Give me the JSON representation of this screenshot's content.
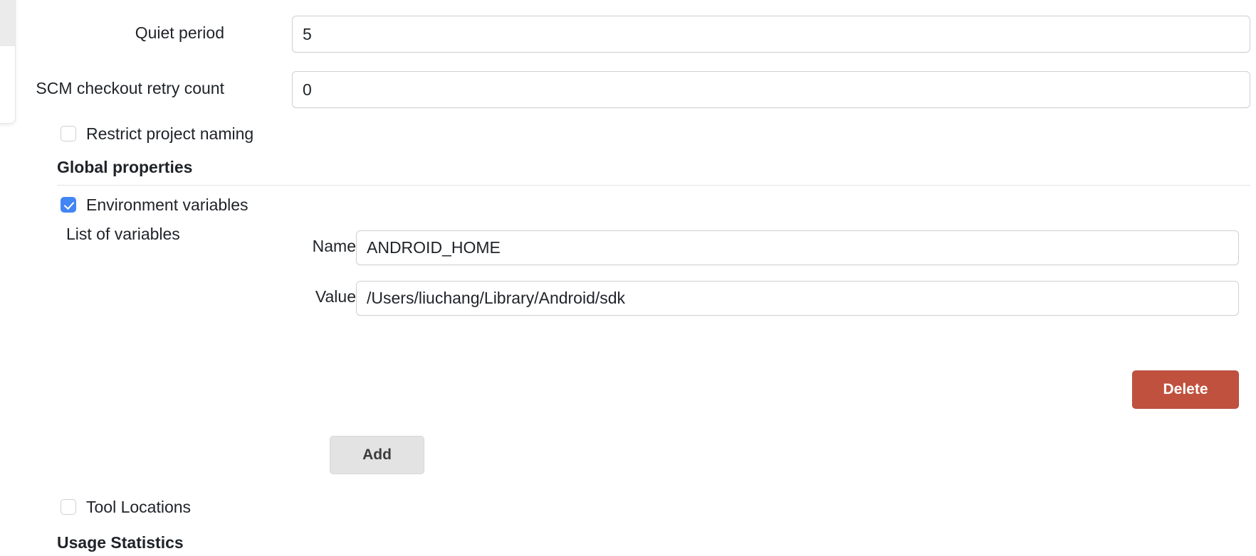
{
  "fields": {
    "quiet_period": {
      "label": "Quiet period",
      "value": "5",
      "placeholder": ""
    },
    "scm_retry": {
      "label": "SCM checkout retry count",
      "value": "0",
      "placeholder": ""
    }
  },
  "checkboxes": {
    "restrict_project_naming": {
      "label": "Restrict project naming",
      "checked": false
    },
    "environment_variables": {
      "label": "Environment variables",
      "checked": true
    },
    "tool_locations": {
      "label": "Tool Locations",
      "checked": false
    }
  },
  "sections": {
    "global_properties": "Global properties",
    "usage_statistics": "Usage Statistics"
  },
  "env_vars": {
    "list_label": "List of variables",
    "name_label": "Name",
    "name_value": "ANDROID_HOME",
    "name_placeholder": "",
    "value_label": "Value",
    "value_value": "/Users/liuchang/Library/Android/sdk",
    "value_placeholder": "",
    "delete_label": "Delete",
    "add_label": "Add"
  },
  "colors": {
    "checkbox_accent": "#4285f4",
    "danger": "#c0513e",
    "secondary": "#e3e3e3",
    "text": "#1f2328",
    "border": "#d0d0d0"
  }
}
